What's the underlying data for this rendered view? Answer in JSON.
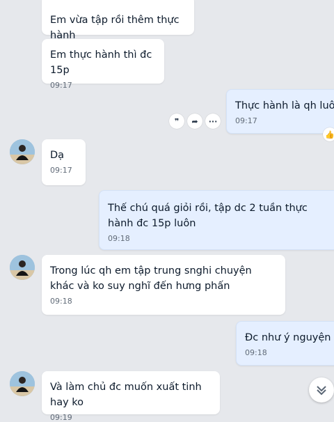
{
  "messages": [
    {
      "text": "Em vừa tập rồi thêm thực hành",
      "time": ""
    },
    {
      "text": "Em thực hành thì đc 15p",
      "time": "09:17"
    },
    {
      "text": "Thực hành là qh luôn ?",
      "time": "09:17"
    },
    {
      "text": "Dạ",
      "time": "09:17"
    },
    {
      "text": "Thế chú quá giỏi rồi, tập dc 2 tuần thực hành đc 15p luôn",
      "time": "09:18"
    },
    {
      "text": "Trong lúc qh em tập trung snghi chuyện khác và ko suy nghĩ đến hưng phấn",
      "time": "09:18"
    },
    {
      "text": "Đc như ý nguyện rồi",
      "time": "09:18"
    },
    {
      "text": "Và làm chủ đc muốn xuất tinh hay ko",
      "time": "09:19"
    }
  ],
  "actions": {
    "quote": "❞",
    "share": "➦",
    "more": "···"
  },
  "like_icon": "👍",
  "colors": {
    "background": "#e6e8ec",
    "incoming_bubble": "#ffffff",
    "outgoing_bubble": "#e5efff"
  }
}
